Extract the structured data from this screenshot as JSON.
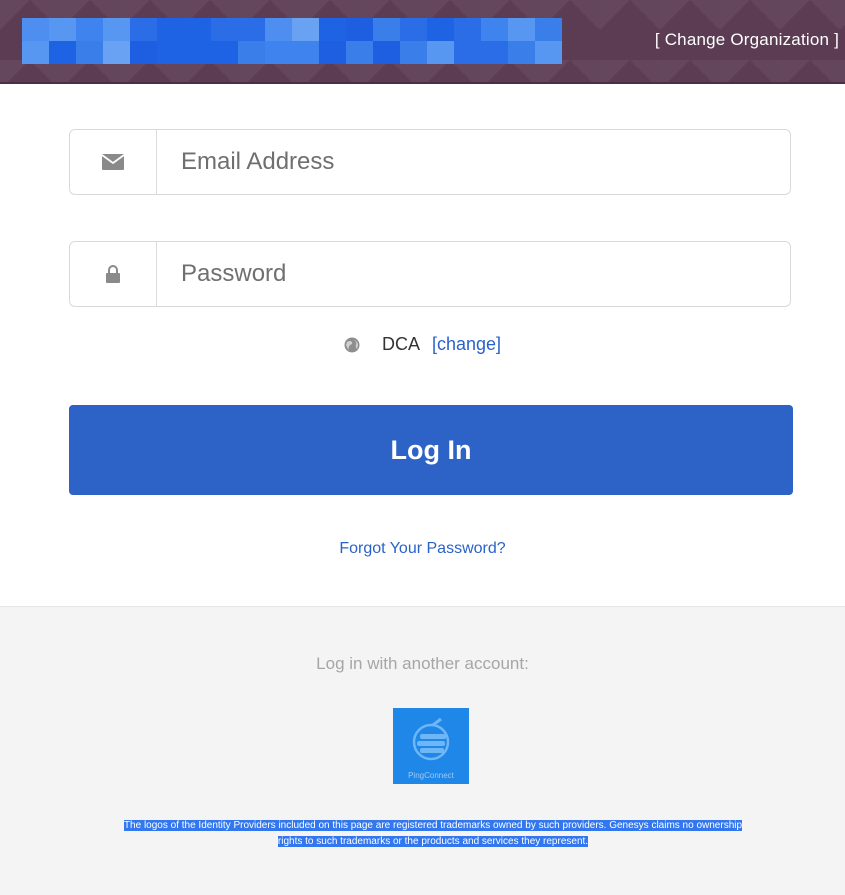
{
  "header": {
    "change_org_label": "[ Change Organization ]",
    "org_name_redacted_colors": [
      "#3a7ee9",
      "#1d5fe0",
      "#4d8ef0",
      "#2a6de6",
      "#6aa2f3",
      "#1e63e3",
      "#3f84ee",
      "#5797f1"
    ]
  },
  "login": {
    "email_placeholder": "Email Address",
    "email_value": "",
    "email_icon": "envelope-icon",
    "password_placeholder": "Password",
    "password_value": "",
    "password_icon": "lock-icon",
    "region_icon": "globe-icon",
    "region_code": "DCA",
    "region_change_label": "[change]",
    "submit_label": "Log In",
    "forgot_label": "Forgot Your Password?"
  },
  "alternate": {
    "title": "Log in with another account:",
    "provider_icon": "ping-connect-logo",
    "provider_label": "PingConnect",
    "disclaimer_line1": "The logos of the Identity Providers included on this page are registered trademarks owned by such providers. Genesys claims no ownership",
    "disclaimer_line2": "rights to such trademarks or the products and services they represent."
  },
  "colors": {
    "header_bg": "#5b3c53",
    "primary": "#2d62c6",
    "link": "#2a62c9",
    "provider_bg": "#1e87e8"
  }
}
